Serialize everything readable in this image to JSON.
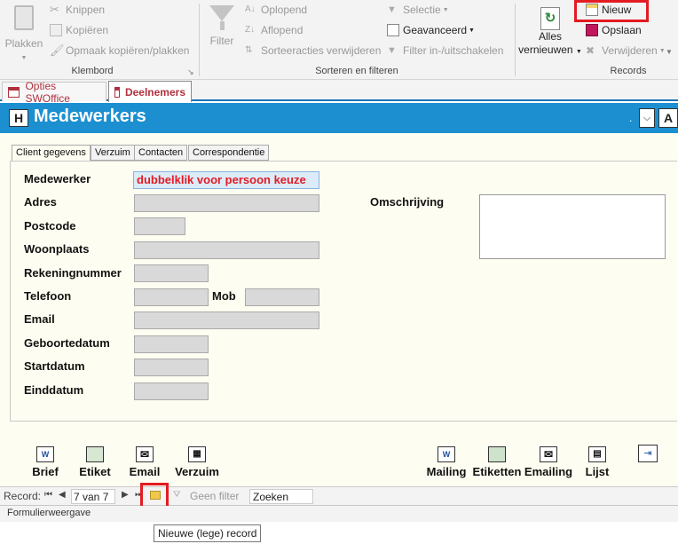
{
  "ribbon": {
    "clipboard": {
      "paste_label": "Plakken",
      "cut_label": "Knippen",
      "copy_label": "Kopiëren",
      "format_painter_label": "Opmaak kopiëren/plakken",
      "group_label": "Klembord"
    },
    "sort_filter": {
      "filter_label": "Filter",
      "ascending_label": "Oplopend",
      "descending_label": "Aflopend",
      "remove_sort_label": "Sorteeracties verwijderen",
      "selection_label": "Selectie",
      "advanced_label": "Geavanceerd",
      "toggle_filter_label": "Filter in-/uitschakelen",
      "group_label": "Sorteren en filteren"
    },
    "records": {
      "refresh_label_1": "Alles",
      "refresh_label_2": "vernieuwen",
      "new_label": "Nieuw",
      "save_label": "Opslaan",
      "delete_label": "Verwijderen",
      "group_label": "Records"
    }
  },
  "doc_tabs": [
    {
      "label": "Opties SWOffice"
    },
    {
      "label": "Deelnemers"
    }
  ],
  "form": {
    "header_button": "H",
    "title": "Medewerkers",
    "dot": ".",
    "header_a": "A",
    "tabs": [
      {
        "label": "Client gegevens"
      },
      {
        "label": "Verzuim"
      },
      {
        "label": "Contacten"
      },
      {
        "label": "Correspondentie"
      }
    ],
    "fields": {
      "medewerker_label": "Medewerker",
      "medewerker_value": "dubbelklik voor persoon keuze",
      "adres_label": "Adres",
      "postcode_label": "Postcode",
      "woonplaats_label": "Woonplaats",
      "rekeningnummer_label": "Rekeningnummer",
      "telefoon_label": "Telefoon",
      "mob_label": "Mob",
      "email_label": "Email",
      "geboortedatum_label": "Geboortedatum",
      "startdatum_label": "Startdatum",
      "einddatum_label": "Einddatum",
      "omschrijving_label": "Omschrijving"
    },
    "buttons_left": [
      {
        "label": "Brief"
      },
      {
        "label": "Etiket"
      },
      {
        "label": "Email"
      },
      {
        "label": "Verzuim"
      }
    ],
    "buttons_right": [
      {
        "label": "Mailing"
      },
      {
        "label": "Etiketten"
      },
      {
        "label": "Emailing"
      },
      {
        "label": "Lijst"
      }
    ]
  },
  "nav": {
    "record_label": "Record:",
    "position": "7 van 7",
    "no_filter": "Geen filter",
    "search": "Zoeken"
  },
  "status": {
    "view_label": "Formulierweergave"
  },
  "tooltip": "Nieuwe (lege) record",
  "colors": {
    "accent": "#1c8fd0",
    "highlight": "#e31b23",
    "tab_text": "#b0313d"
  }
}
